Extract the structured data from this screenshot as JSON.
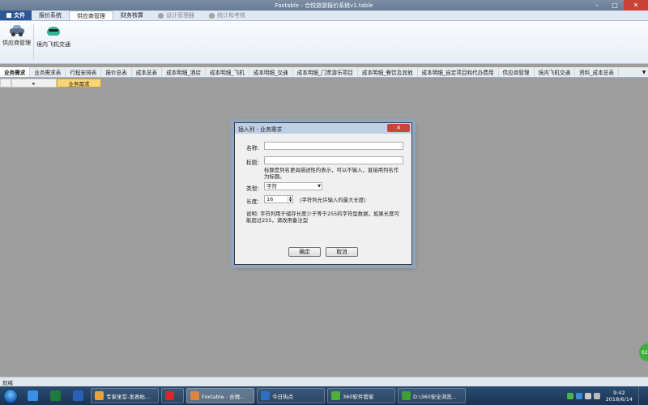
{
  "window": {
    "title": "Foxtable - 合悦旅游报价系统v1.table",
    "min_glyph": "–",
    "max_glyph": "□",
    "close_glyph": "✕"
  },
  "ribbon_tabs": [
    {
      "label": "文件"
    },
    {
      "label": "报价系统"
    },
    {
      "label": "供应商管理"
    },
    {
      "label": "财务核算"
    },
    {
      "label": "设计管理器"
    },
    {
      "label": "统计和考核"
    }
  ],
  "ribbon_buttons": [
    {
      "label": "供应商管理"
    },
    {
      "label": "境内飞机交通"
    }
  ],
  "doc_tabs": [
    "业务需求",
    "业务需求表",
    "行程安排表",
    "报价总表",
    "成本总表",
    "成本明细_酒店",
    "成本明细_飞机",
    "成本明细_交通",
    "成本明细_门票游乐项目",
    "成本明细_餐饮及其他",
    "成本明细_自定项目和代办费用",
    "供应商管理",
    "境内飞机交通",
    "资料_成本总表"
  ],
  "grid": {
    "row_marker": "▸",
    "selected_column": "业务需求"
  },
  "dialog": {
    "title": "插入列 - 业务需求",
    "close_glyph": "✕",
    "name_label": "名称:",
    "name_value": "",
    "caption_label": "标题:",
    "caption_value": "",
    "caption_hint": "标题是列名更具描述性的表示，可以不输入，直接用列名作为标题。",
    "type_label": "类型:",
    "type_value": "字符",
    "length_label": "长度:",
    "length_value": "16",
    "length_hint": "(字符列允许输入的最大长度)",
    "note": "说明: 字符列用于储存长度少于等于255的字符型数据，如果长度可能超过255，请改用备注型",
    "ok_label": "确定",
    "cancel_label": "取消"
  },
  "status": {
    "text": "就绪"
  },
  "badge_text": "62",
  "taskbar": {
    "tasks": [
      {
        "label": "专家坐堂-发表帖...",
        "color": "#e8a23c"
      },
      {
        "label": "",
        "color": "#d8262f"
      },
      {
        "label": "Foxtable - 合悦...",
        "color": "#e0843a"
      },
      {
        "label": "今日热点",
        "color": "#2e6fc4"
      },
      {
        "label": "360软件管家",
        "color": "#4cae3f"
      },
      {
        "label": "D:\\360安全浏览...",
        "color": "#3e9f36"
      }
    ],
    "time": "9:42",
    "date": "2018/6/14"
  }
}
